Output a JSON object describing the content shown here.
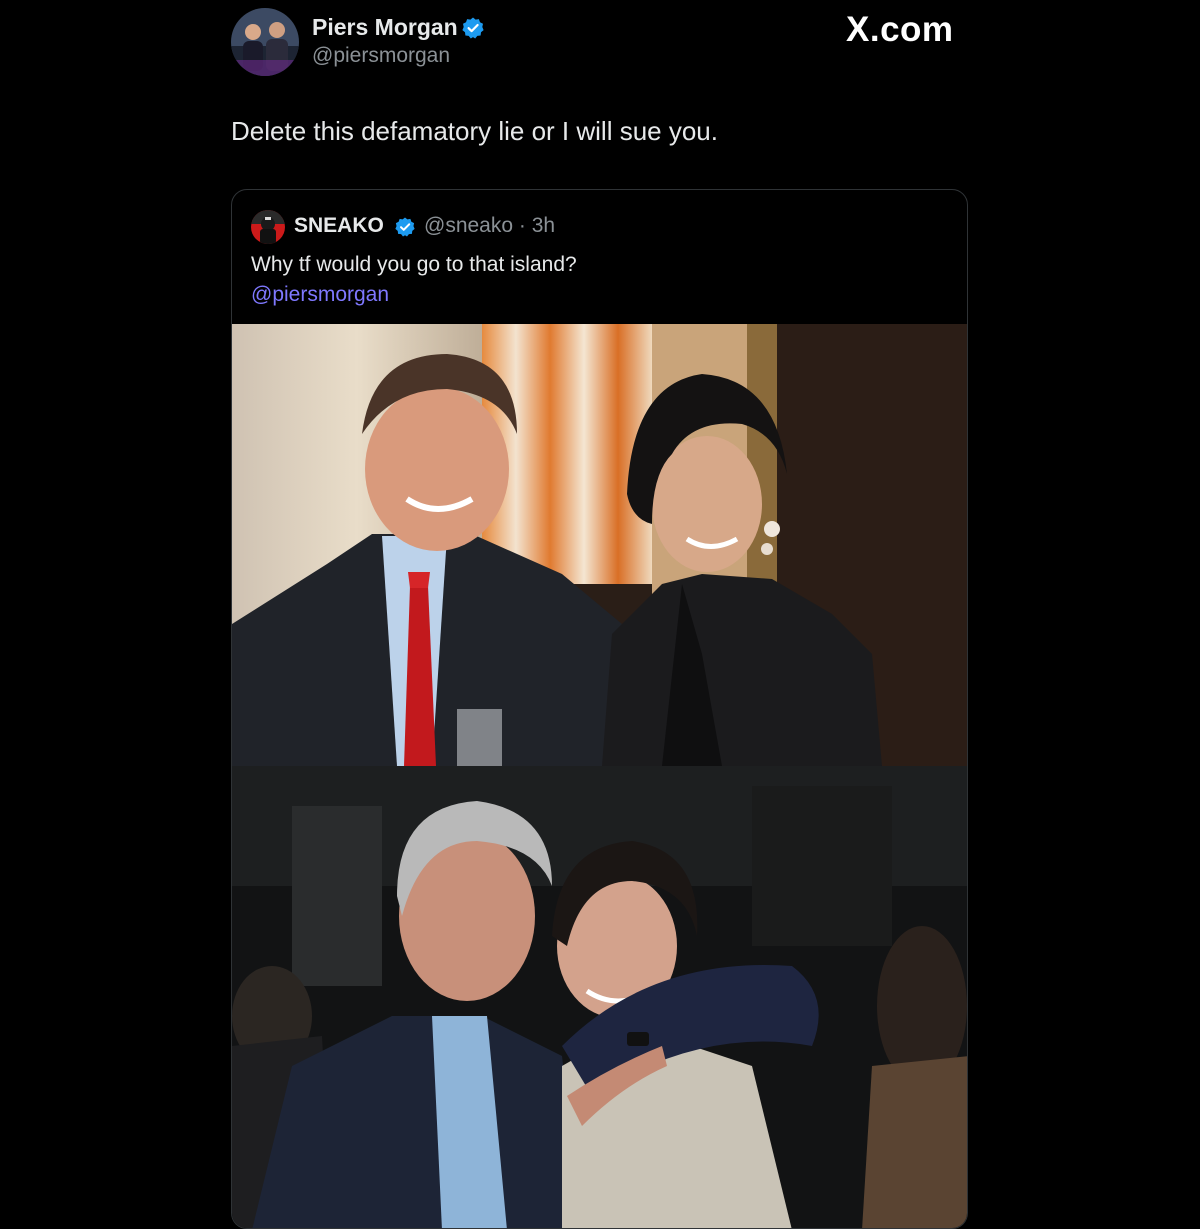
{
  "tweet": {
    "author": {
      "name": "Piers Morgan",
      "handle": "@piersmorgan",
      "verified": true,
      "avatar_icon": "profile-photo-icon"
    },
    "text": "Delete this defamatory lie or I will sue you.",
    "site_label": "X.com"
  },
  "quoted_tweet": {
    "author": {
      "name": "SNEAKO",
      "handle": "@sneako",
      "verified": true,
      "avatar_icon": "profile-photo-icon"
    },
    "meta": "@sneako · 3h",
    "time": "3h",
    "text": "Why tf would you go to that island?",
    "mention": "@piersmorgan",
    "media": [
      {
        "icon": "photo-two-people-posing-indoors"
      },
      {
        "icon": "photo-two-people-embracing-at-night-party"
      }
    ]
  },
  "colors": {
    "background": "#000000",
    "primary_text": "#e7e9ea",
    "secondary_text": "#8b9196",
    "verified_badge": "#1d9bf0",
    "mention_link": "#7f78ff",
    "card_border": "#2f3336"
  }
}
